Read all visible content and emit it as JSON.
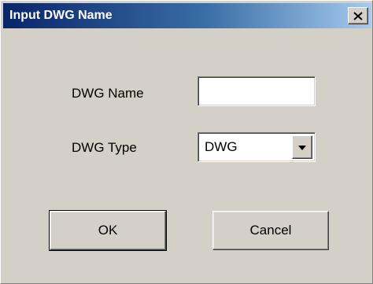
{
  "window": {
    "title": "Input DWG Name",
    "close_icon": "close-icon"
  },
  "form": {
    "name_label": "DWG Name",
    "name_value": "",
    "type_label": "DWG Type",
    "type_selected": "DWG",
    "type_arrow_icon": "chevron-down-icon"
  },
  "buttons": {
    "ok_label": "OK",
    "cancel_label": "Cancel"
  },
  "colors": {
    "title_gradient_start": "#0a246a",
    "title_gradient_end": "#a6caf0",
    "dialog_face": "#d4d0c8"
  }
}
